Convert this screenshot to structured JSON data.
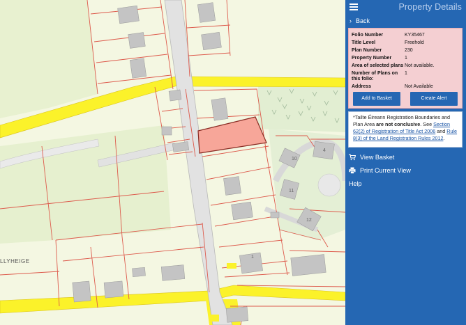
{
  "panel": {
    "title": "Property Details",
    "back_label": "Back",
    "details": [
      {
        "label": "Folio Number",
        "value": "KY35467"
      },
      {
        "label": "Title Level",
        "value": "Freehold"
      },
      {
        "label": "Plan Number",
        "value": "230"
      },
      {
        "label": "Property Number",
        "value": "1"
      },
      {
        "label": "Area of selected plans",
        "value": "Not available."
      },
      {
        "label": "Number of Plans on this folio:",
        "value": "1"
      },
      {
        "label": "Address",
        "value": "Not Available"
      }
    ],
    "add_basket_label": "Add to Basket",
    "create_alert_label": "Create Alert",
    "disclaimer": {
      "p1": "*Tailte Éireann Registration Boundaries and Plan Area ",
      "p2": "are not conclusive",
      "p3": ". See ",
      "link1": "Section 62(2) of Registration of Title Act 2006",
      "p4": " and ",
      "link2": "Rule 8(3) of the Land Registration Rules 2012",
      "p5": "."
    },
    "menu": {
      "view_basket": "View Basket",
      "print": "Print Current View",
      "help": "Help"
    }
  },
  "map": {
    "place_label": "LLYHEIGE",
    "plot_numbers": [
      "10",
      "11",
      "12",
      "1",
      "4"
    ],
    "colors": {
      "background": "#f4f7e2",
      "field": "#e7f0cf",
      "road_yellow": "#fbf22a",
      "road_grey": "#dcdcdc",
      "boundary": "#dd5a4c",
      "building": "#c4c4c4",
      "selected_plot": "#f7a699",
      "woodland": "#e2eed2",
      "highlight_panel": "#f4cfd2",
      "panel_blue": "#2567b3"
    }
  }
}
